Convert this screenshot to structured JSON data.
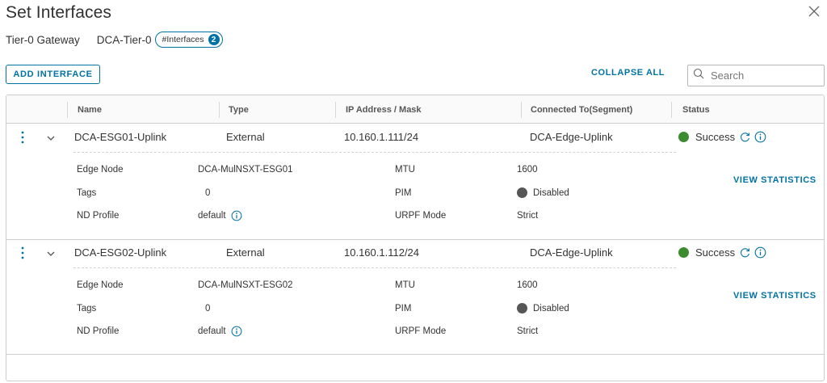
{
  "modal": {
    "title": "Set Interfaces",
    "gateway_label": "Tier-0 Gateway",
    "gateway_name": "DCA-Tier-0",
    "interfaces_pill_label": "#Interfaces",
    "interfaces_count": "2"
  },
  "toolbar": {
    "add_label": "ADD INTERFACE",
    "collapse_label": "COLLAPSE ALL",
    "search_placeholder": "Search"
  },
  "columns": [
    "Name",
    "Type",
    "IP Address / Mask",
    "Connected To(Segment)",
    "Status"
  ],
  "detail_labels": {
    "edge_node": "Edge Node",
    "tags": "Tags",
    "nd_profile": "ND Profile",
    "mtu": "MTU",
    "pim": "PIM",
    "urpf": "URPF Mode"
  },
  "view_stats_label": "VIEW STATISTICS",
  "rows": [
    {
      "name": "DCA-ESG01-Uplink",
      "type": "External",
      "ip": "10.160.1.111/24",
      "segment": "DCA-Edge-Uplink",
      "status": "Success",
      "edge_node": "DCA-MulNSXT-ESG01",
      "tags": "0",
      "nd_profile": "default",
      "mtu": "1600",
      "pim": "Disabled",
      "urpf": "Strict"
    },
    {
      "name": "DCA-ESG02-Uplink",
      "type": "External",
      "ip": "10.160.1.112/24",
      "segment": "DCA-Edge-Uplink",
      "status": "Success",
      "edge_node": "DCA-MulNSXT-ESG02",
      "tags": "0",
      "nd_profile": "default",
      "mtu": "1600",
      "pim": "Disabled",
      "urpf": "Strict"
    }
  ],
  "colors": {
    "accent": "#0072a3",
    "success": "#3d8b2f",
    "disabled": "#565656"
  }
}
